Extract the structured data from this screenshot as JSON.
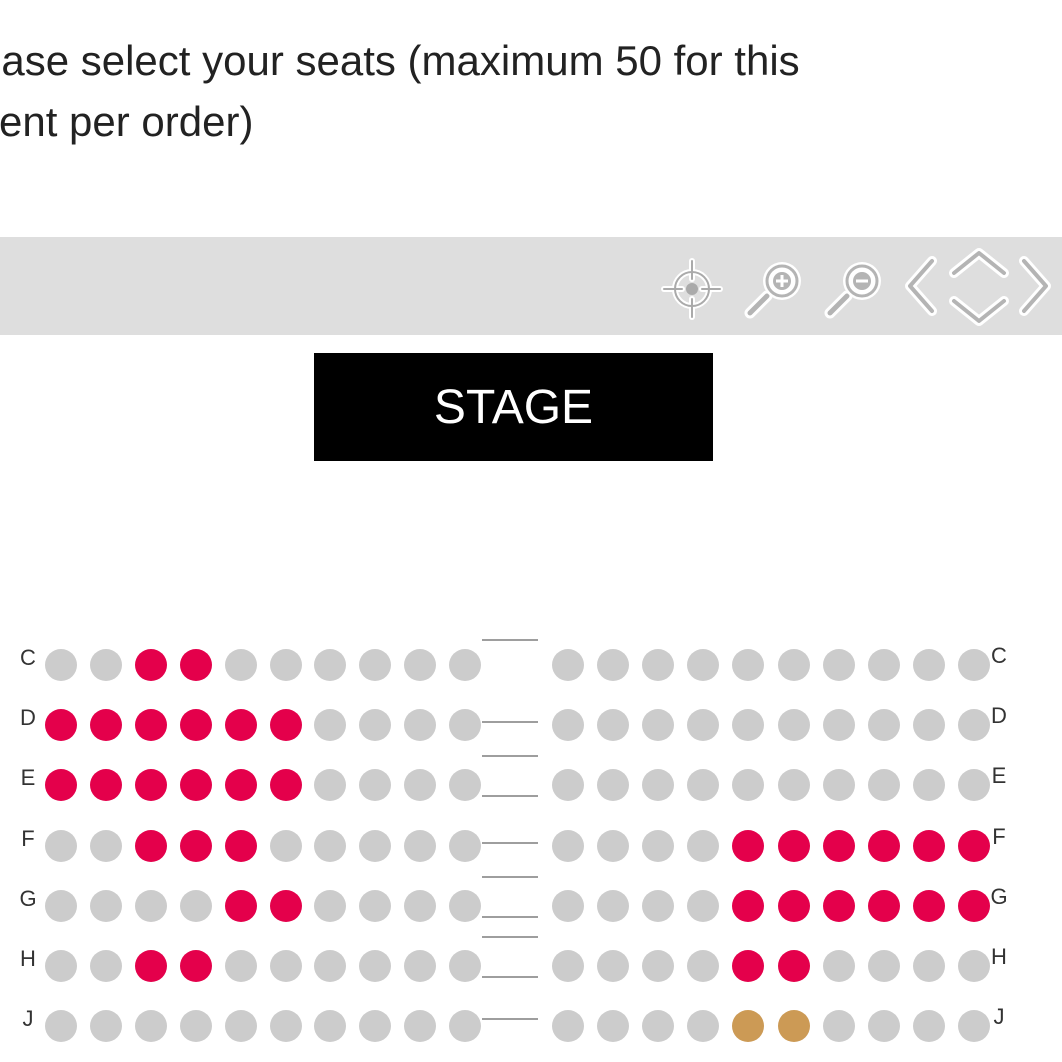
{
  "instruction": "ease select your seats (maximum 50 for this vent per order)",
  "instruction_lines": [
    "ease select your seats (maximum 50 for this",
    "vent per order)"
  ],
  "toolbar": {
    "tools": [
      {
        "name": "recenter-icon",
        "interactable": true
      },
      {
        "name": "zoom-in-icon",
        "interactable": true
      },
      {
        "name": "zoom-out-icon",
        "interactable": true
      },
      {
        "name": "pan-left-icon",
        "interactable": true
      },
      {
        "name": "pan-up-down-icon",
        "interactable": true
      },
      {
        "name": "pan-right-icon",
        "interactable": true
      }
    ]
  },
  "stage_label": "STAGE",
  "colors": {
    "available": "#cccccc",
    "sold": "#e4004b",
    "held": "#cc9a55",
    "toolbar": "#dedede",
    "stage": "#000000"
  },
  "seat_status_legend": {
    ".": "available",
    "x": "sold",
    "o": "held"
  },
  "rows": [
    {
      "label": "C",
      "left": "..xx......",
      "right": ".........."
    },
    {
      "label": "D",
      "left": "xxxxxx....",
      "right": ".........."
    },
    {
      "label": "E",
      "left": "xxxxxx....",
      "right": ".........."
    },
    {
      "label": "F",
      "left": "..xxx.....",
      "right": "....xxxxxx"
    },
    {
      "label": "G",
      "left": "....xx....",
      "right": "....xxxxxx"
    },
    {
      "label": "H",
      "left": "..xx......",
      "right": "....xx...."
    },
    {
      "label": "J",
      "left": "..........",
      "right": "....oo...."
    }
  ]
}
